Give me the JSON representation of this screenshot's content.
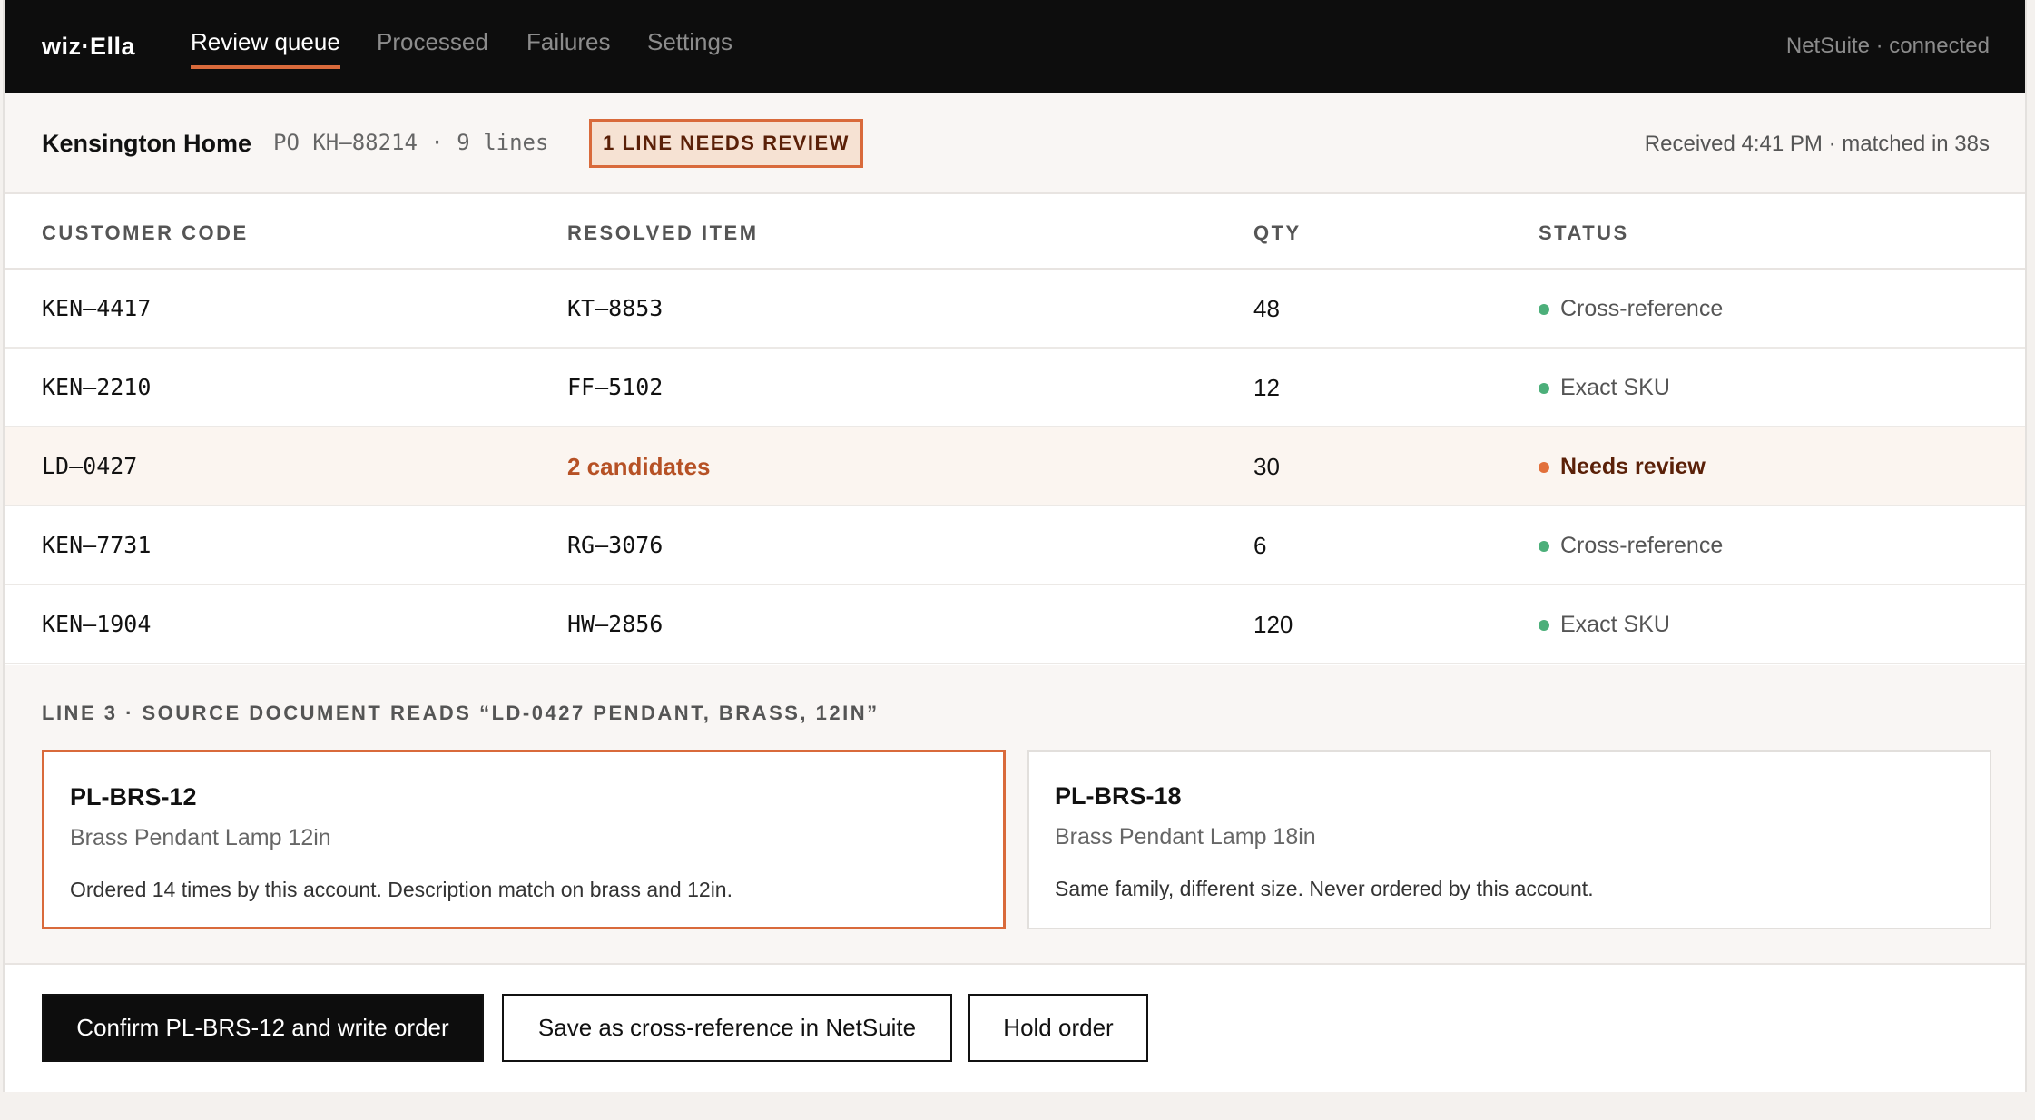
{
  "nav": {
    "logo": "wiz·Ella",
    "tabs": [
      {
        "label": "Review queue",
        "active": true
      },
      {
        "label": "Processed"
      },
      {
        "label": "Failures"
      },
      {
        "label": "Settings"
      }
    ],
    "connection": "NetSuite · connected"
  },
  "order": {
    "customer": "Kensington Home",
    "po": "PO KH–88214 · 9 lines",
    "badge": "1 LINE NEEDS REVIEW",
    "received": "Received 4:41 PM · matched in 38s"
  },
  "table": {
    "headers": [
      "CUSTOMER CODE",
      "RESOLVED ITEM",
      "QTY",
      "STATUS"
    ],
    "rows": [
      {
        "code": "KEN–4417",
        "item": "KT–8853",
        "qty": "48",
        "status": "Cross-reference"
      },
      {
        "code": "KEN–2210",
        "item": "FF–5102",
        "qty": "12",
        "status": "Exact SKU"
      },
      {
        "code": "LD–0427",
        "item": "2 candidates",
        "qty": "30",
        "status": "Needs review"
      },
      {
        "code": "KEN–7731",
        "item": "RG–3076",
        "qty": "6",
        "status": "Cross-reference"
      },
      {
        "code": "KEN–1904",
        "item": "HW–2856",
        "qty": "120",
        "status": "Exact SKU"
      }
    ]
  },
  "colors": {
    "accent": "#d96a3b",
    "ok": "#4caf7a",
    "warn": "#e2703b"
  },
  "review": {
    "title": "LINE 3 · SOURCE DOCUMENT READS “LD-0427 PENDANT, BRASS, 12IN”",
    "candidates": [
      {
        "sku": "PL-BRS-12",
        "desc": "Brass Pendant Lamp 12in",
        "note": "Ordered 14 times by this account. Description match on brass and 12in."
      },
      {
        "sku": "PL-BRS-18",
        "desc": "Brass Pendant Lamp 18in",
        "note": "Same family, different size. Never ordered by this account."
      }
    ]
  },
  "actions": {
    "confirm": "Confirm PL-BRS-12 and write order",
    "save_xref": "Save as cross-reference in NetSuite",
    "hold": "Hold order"
  }
}
